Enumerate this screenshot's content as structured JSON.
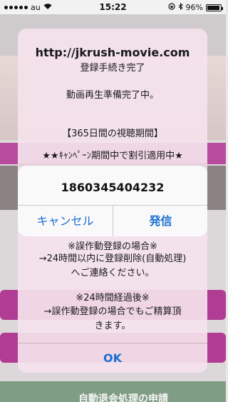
{
  "status_bar": {
    "carrier": "au",
    "time": "15:22",
    "battery": "96%"
  },
  "background_page": {
    "bottom_button_label": "自動退会処理の申請"
  },
  "main_alert": {
    "title": "http://jkrush-movie.com",
    "lines": [
      "登録手続き完了",
      "動画再生準備完了中。",
      "【365日間の視聴期間】",
      "★★ｷｬﾝﾍﾟｰﾝ期間中で割引適用中★",
      "※誤作動登録の場合※",
      "→24時間以内に登録削除(自動処理)",
      "へご連絡ください。",
      "※24時間経過後※",
      "→誤作動登録の場合でもご精算頂",
      "きます。"
    ],
    "ok_label": "OK"
  },
  "call_alert": {
    "number": "1860345404232",
    "cancel_label": "キャンセル",
    "send_label": "発信"
  },
  "colors": {
    "accent_blue": "#1a6fd0",
    "pink": "#b13c93"
  }
}
